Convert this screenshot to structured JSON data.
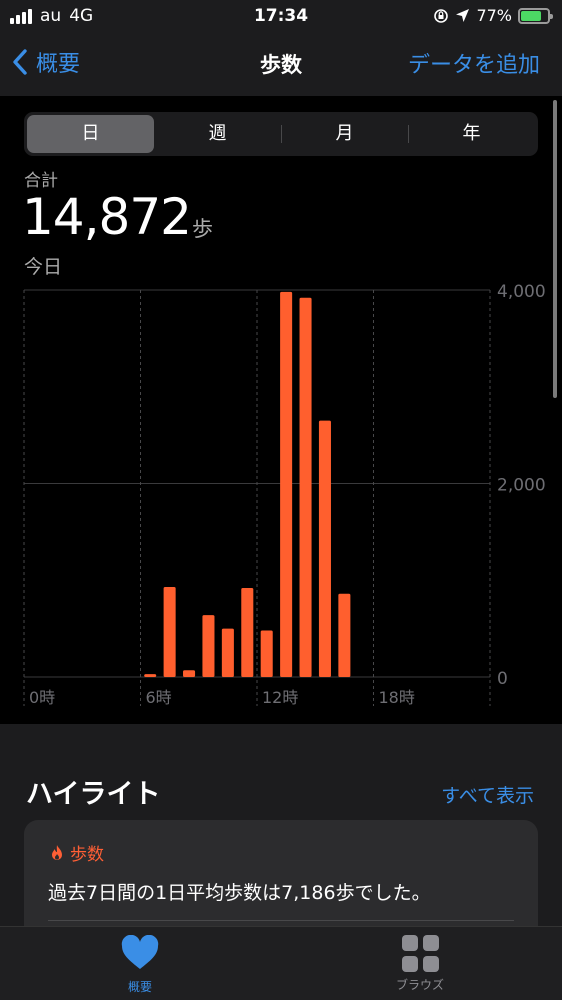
{
  "status": {
    "carrier": "au",
    "network": "4G",
    "time": "17:34",
    "battery": "77%",
    "battery_level": 0.77
  },
  "nav": {
    "back_label": "概要",
    "title": "歩数",
    "action_label": "データを追加"
  },
  "segments": [
    "日",
    "週",
    "月",
    "年"
  ],
  "selected_segment": "日",
  "summary": {
    "label": "合計",
    "value": "14,872",
    "unit": "歩",
    "period": "今日"
  },
  "chart_data": {
    "type": "bar",
    "xlabel": "",
    "ylabel": "",
    "x_tick_labels": [
      "0時",
      "6時",
      "12時",
      "18時"
    ],
    "y_tick_labels": [
      "4,000",
      "2,000",
      "0"
    ],
    "ylim": [
      0,
      4000
    ],
    "xlim": [
      0,
      24
    ],
    "series": [
      {
        "hours": [
          6,
          7,
          8,
          9,
          10,
          11,
          12,
          13,
          14,
          15,
          16
        ],
        "values": [
          30,
          930,
          70,
          640,
          500,
          920,
          480,
          3980,
          3920,
          2650,
          860
        ],
        "color": "#ff5f2e"
      }
    ],
    "grid": true
  },
  "highlights": {
    "title": "ハイライト",
    "see_all": "すべて表示",
    "card": {
      "category": "歩数",
      "text": "過去7日間の1日平均歩数は7,186歩でした。",
      "accent_color": "#ff5f35"
    }
  },
  "tabs": [
    {
      "label": "概要",
      "icon": "heart-icon",
      "active": true
    },
    {
      "label": "ブラウズ",
      "icon": "grid-icon",
      "active": false
    }
  ],
  "colors": {
    "accent": "#3a8ee6",
    "bar": "#ff5f2e"
  }
}
